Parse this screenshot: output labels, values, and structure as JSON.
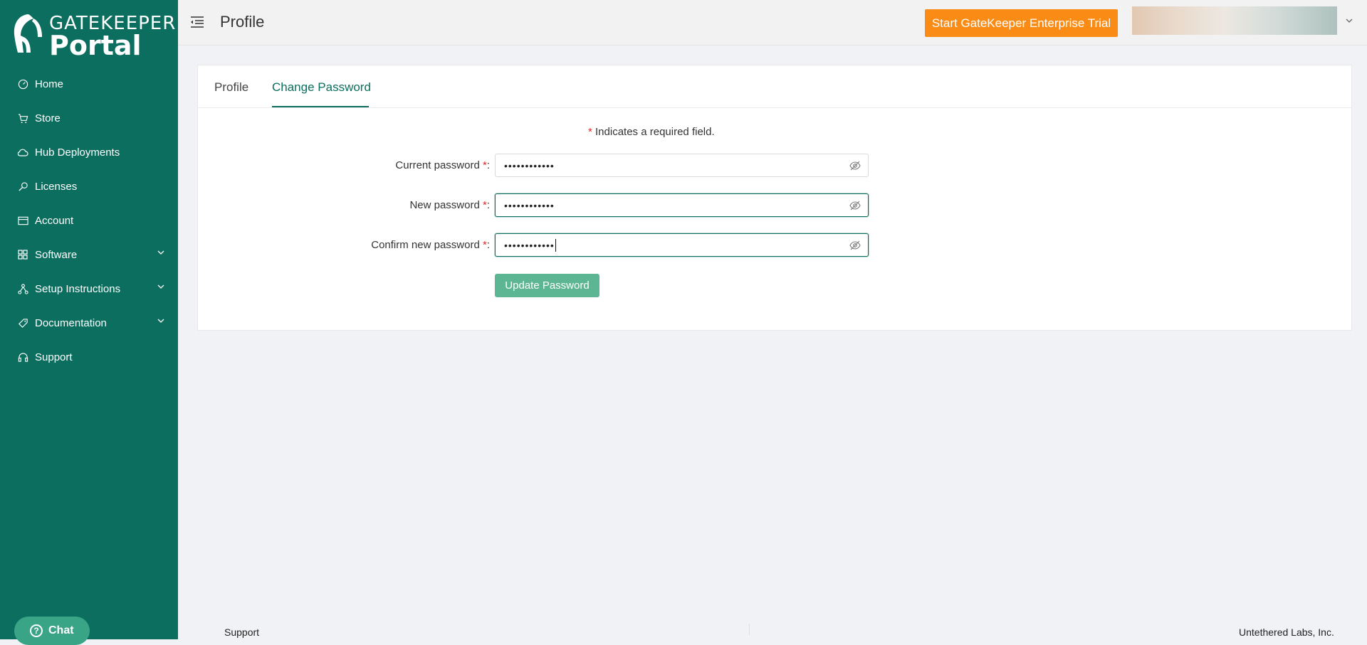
{
  "brand": {
    "line1": "GATEKEEPER",
    "line2": "Portal"
  },
  "sidebar": {
    "items": [
      {
        "label": "Home",
        "icon": "dashboard-icon"
      },
      {
        "label": "Store",
        "icon": "cart-icon"
      },
      {
        "label": "Hub Deployments",
        "icon": "cloud-icon"
      },
      {
        "label": "Licenses",
        "icon": "key-icon"
      },
      {
        "label": "Account",
        "icon": "card-icon"
      },
      {
        "label": "Software",
        "icon": "grid-icon",
        "expandable": true
      },
      {
        "label": "Setup Instructions",
        "icon": "network-icon",
        "expandable": true
      },
      {
        "label": "Documentation",
        "icon": "tag-icon",
        "expandable": true
      },
      {
        "label": "Support",
        "icon": "headset-icon"
      }
    ]
  },
  "chat": {
    "label": "Chat"
  },
  "header": {
    "title": "Profile",
    "trial_button": "Start GateKeeper Enterprise Trial"
  },
  "tabs": [
    {
      "label": "Profile",
      "active": false
    },
    {
      "label": "Change Password",
      "active": true
    }
  ],
  "form": {
    "required_note_star": "*",
    "required_note_pre": " Indicates a ",
    "required_note_bold": "required",
    "required_note_post": " field.",
    "fields": [
      {
        "label": "Current password",
        "value": "••••••••••••",
        "focused": false
      },
      {
        "label": "New password",
        "value": "••••••••••••",
        "focused": true
      },
      {
        "label": "Confirm new password",
        "value": "••••••••••••",
        "focused": true
      }
    ],
    "submit_label": "Update Password"
  },
  "footer": {
    "left": "Support",
    "right": "Untethered Labs, Inc."
  },
  "colors": {
    "sidebar": "#0b6e5e",
    "accent": "#fa8c16",
    "submit": "#5db693"
  }
}
